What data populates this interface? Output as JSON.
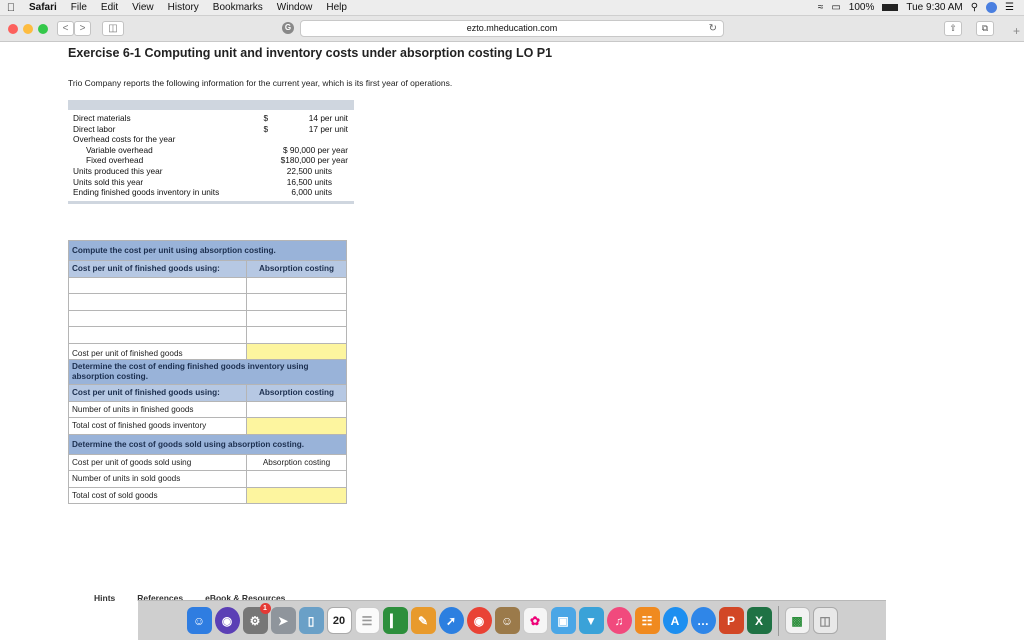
{
  "menubar": {
    "app": "Safari",
    "items": [
      "File",
      "Edit",
      "View",
      "History",
      "Bookmarks",
      "Window",
      "Help"
    ],
    "battery": "100%",
    "clock": "Tue 9:30 AM"
  },
  "browser": {
    "url": "ezto.mheducation.com",
    "favicon_letter": "G",
    "back": "<",
    "forward": ">"
  },
  "exercise": {
    "title": "Exercise 6-1 Computing unit and inventory costs under absorption costing LO P1",
    "intro": "Trio Company reports the following information for the current year, which is its first year of operations."
  },
  "given": {
    "direct_materials_label": "Direct materials",
    "direct_materials_cur": "$",
    "direct_materials_value": "14 per unit",
    "direct_labor_label": "Direct labor",
    "direct_labor_cur": "$",
    "direct_labor_value": "17 per unit",
    "overhead_label": "Overhead costs for the year",
    "variable_overhead_label": "Variable overhead",
    "variable_overhead_value": "$ 90,000 per year",
    "fixed_overhead_label": "Fixed overhead",
    "fixed_overhead_value": "$180,000 per year",
    "units_produced_label": "Units produced this year",
    "units_produced_value": "22,500 units",
    "units_sold_label": "Units sold this year",
    "units_sold_value": "16,500 units",
    "ending_inventory_label": "Ending finished goods inventory in units",
    "ending_inventory_value": "6,000 units"
  },
  "answer": {
    "part1_title": "Compute the cost per unit using absorption costing.",
    "part1_col1": "Cost per unit of finished goods using:",
    "part1_col2": "Absorption costing",
    "part1_total_label": "Cost per unit of finished goods",
    "part2_title": "Determine the cost of ending finished goods inventory using absorption costing.",
    "part2_col1": "Cost per unit of finished goods using:",
    "part2_col2": "Absorption costing",
    "part2_row1": "Number of units in finished goods",
    "part2_row2": "Total cost of finished goods inventory",
    "part3_title": "Determine the cost of goods sold using absorption costing.",
    "part3_row1": "Cost per unit of goods sold using",
    "part3_col2": "Absorption costing",
    "part3_row2": "Number of units in sold goods",
    "part3_row3": "Total cost of sold goods"
  },
  "tabs": [
    "Hints",
    "References",
    "eBook & Resources"
  ],
  "dock": {
    "calendar_day": "20",
    "mail_badge": "1"
  }
}
